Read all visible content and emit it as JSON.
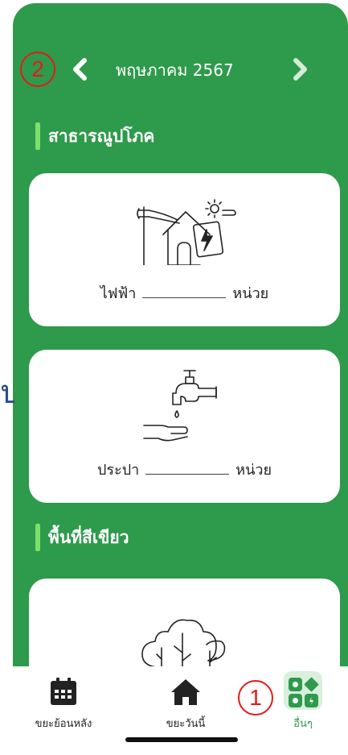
{
  "header": {
    "month_label": "พฤษภาคม 2567",
    "prev_icon": "chevron-left-icon",
    "next_icon": "chevron-right-icon"
  },
  "annotations": {
    "marker_1": "1",
    "marker_2": "2",
    "marker_color": "#e11b1b"
  },
  "sections": {
    "utilities": {
      "title": "สาธารณูปโภค"
    },
    "green_area": {
      "title": "พื้นที่สีเขียว"
    }
  },
  "cards": {
    "electricity": {
      "label": "ไฟฟ้า",
      "unit": "หน่วย",
      "value": "",
      "icon": "electricity-bill-icon"
    },
    "water": {
      "label": "ประปา",
      "unit": "หน่วย",
      "value": "",
      "icon": "water-tap-icon"
    },
    "trees": {
      "icon": "trees-icon"
    }
  },
  "edge_glyph": "ป",
  "nav": {
    "items": [
      {
        "label": "ขยะย้อนหลัง",
        "icon": "calendar-icon",
        "selected": false
      },
      {
        "label": "ขยะวันนี้",
        "icon": "home-icon",
        "selected": false
      },
      {
        "label": "อื่นๆ",
        "icon": "other-categories-icon",
        "selected": true
      }
    ]
  },
  "colors": {
    "primary_green": "#2e9a4c",
    "accent_bar": "#7ee06b",
    "selected_tab_bg": "#d9f0dc"
  }
}
